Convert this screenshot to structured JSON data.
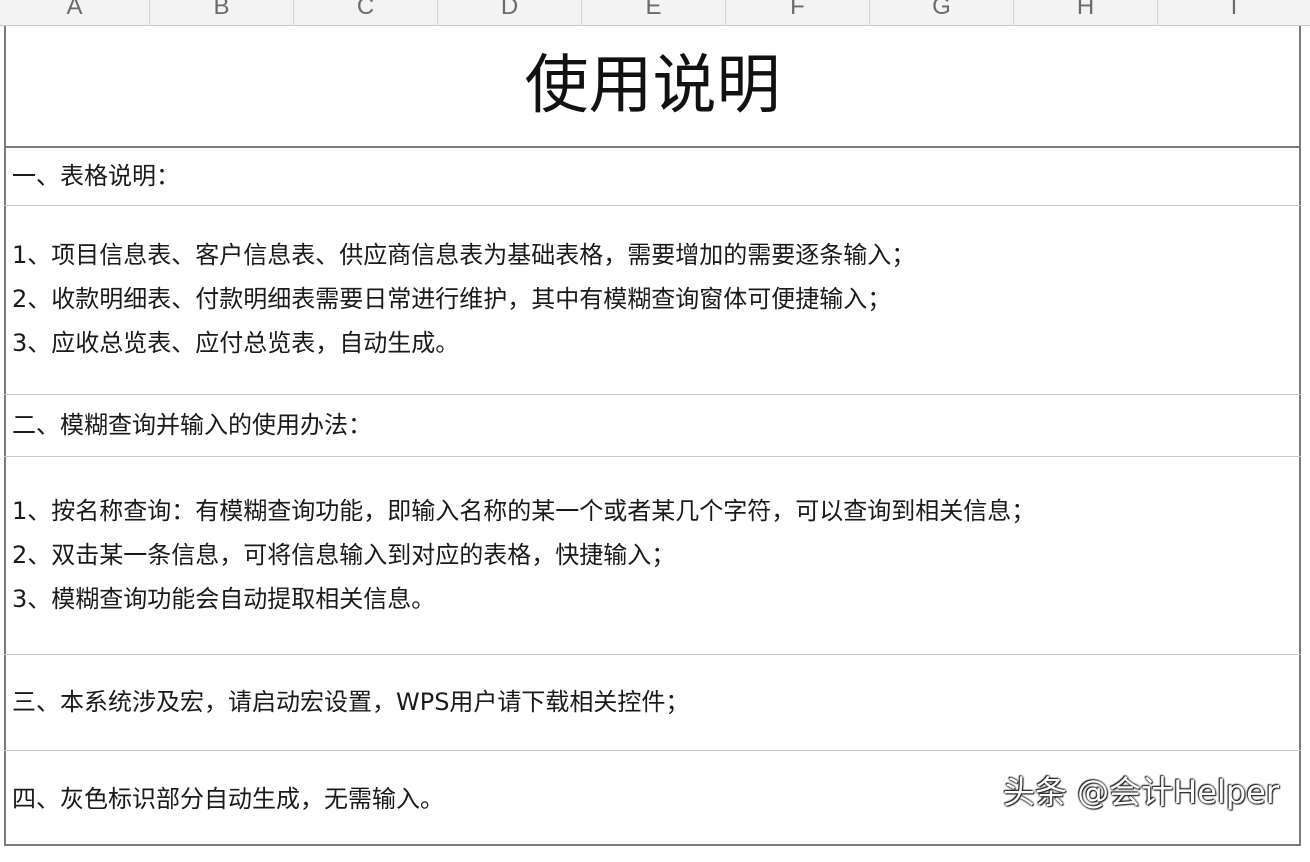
{
  "columns": [
    "A",
    "B",
    "C",
    "D",
    "E",
    "F",
    "G",
    "H",
    "I"
  ],
  "title": "使用说明",
  "sections": {
    "s1_heading": "一、表格说明：",
    "s1_items": [
      "1、项目信息表、客户信息表、供应商信息表为基础表格，需要增加的需要逐条输入；",
      "2、收款明细表、付款明细表需要日常进行维护，其中有模糊查询窗体可便捷输入；",
      "3、应收总览表、应付总览表，自动生成。"
    ],
    "s2_heading": "二、模糊查询并输入的使用办法：",
    "s2_items": [
      "1、按名称查询：有模糊查询功能，即输入名称的某一个或者某几个字符，可以查询到相关信息；",
      "2、双击某一条信息，可将信息输入到对应的表格，快捷输入；",
      "3、模糊查询功能会自动提取相关信息。"
    ],
    "s3": "三、本系统涉及宏，请启动宏设置，WPS用户请下载相关控件；",
    "s4": "四、灰色标识部分自动生成，无需输入。"
  },
  "watermark": "头条 @会计Helper",
  "colors": {
    "grid": "#c8c8c8",
    "border": "#7a7a7a",
    "header_bg": "#f3f3f3"
  }
}
